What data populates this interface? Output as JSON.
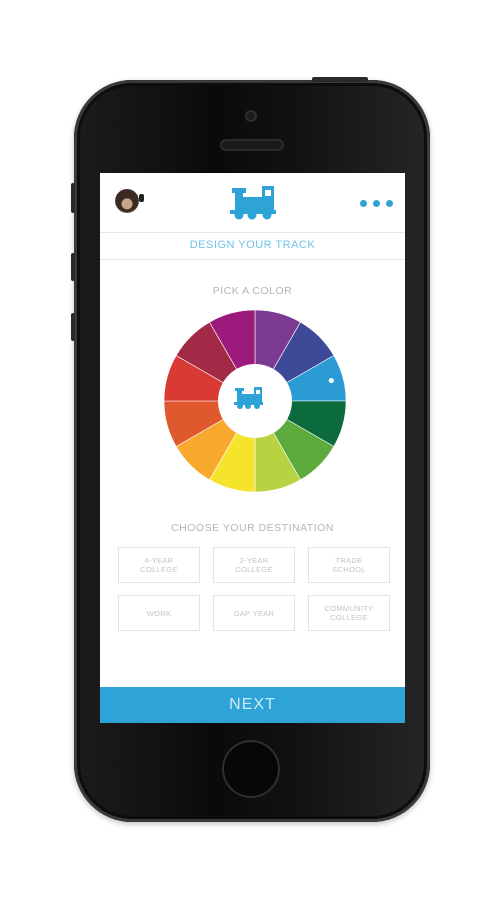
{
  "header": {
    "avatar": "user-avatar",
    "logo_icon": "train-icon",
    "menu_icon": "more-dots-icon",
    "accent_color": "#2ea3d8"
  },
  "subtitle": "DESIGN YOUR TRACK",
  "color_section": {
    "label": "PICK A COLOR",
    "center_icon": "train-icon",
    "selected_color": "#2a9bd5",
    "colors": [
      "#7d3a92",
      "#3d4896",
      "#2a9bd5",
      "#0b6b3c",
      "#5dab3d",
      "#b8d342",
      "#f5e32c",
      "#f9a82e",
      "#e0582d",
      "#da3a34",
      "#a32a47",
      "#9b1a7b"
    ]
  },
  "destination_section": {
    "label": "CHOOSE YOUR DESTINATION",
    "options": [
      {
        "label": "4-YEAR\nCOLLEGE"
      },
      {
        "label": "2-YEAR\nCOLLEGE"
      },
      {
        "label": "TRADE\nSCHOOL"
      },
      {
        "label": "WORK"
      },
      {
        "label": "GAP YEAR"
      },
      {
        "label": "COMMUNITY\nCOLLEGE"
      }
    ]
  },
  "footer": {
    "next_label": "NEXT"
  }
}
